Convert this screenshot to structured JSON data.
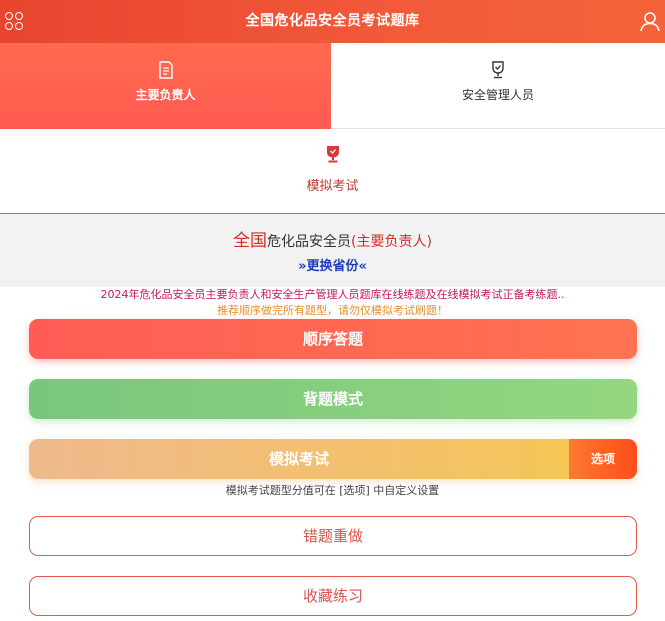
{
  "header": {
    "title": "全国危化品安全员考试题库",
    "menu_icon": "grid-menu-icon",
    "user_icon": "user-icon",
    "accent": "#f25a3a"
  },
  "tabs": [
    {
      "label": "主要负责人",
      "icon": "document-edit-icon",
      "active": true
    },
    {
      "label": "安全管理人员",
      "icon": "trophy-icon",
      "active": false
    }
  ],
  "mock_tab": {
    "label": "模拟考试",
    "icon": "trophy-icon"
  },
  "info": {
    "region": "全国",
    "category": "危化品安全员",
    "role": "(主要负责人)",
    "change_link": "»更换省份«"
  },
  "notice": {
    "line1": "2024年危化品安全员主要负责人和安全生产管理人员题库在线练题及在线模拟考试正备考练题..",
    "line2": "推荐顺序做完所有题型，请勿仅模拟考试刷题！"
  },
  "buttons": {
    "order": "顺序答题",
    "recite": "背题模式",
    "mock": "模拟考试",
    "mock_options": "选项",
    "mock_note": "模拟考试题型分值可在 [选项] 中自定义设置",
    "redo": "错题重做",
    "favorite": "收藏练习"
  }
}
